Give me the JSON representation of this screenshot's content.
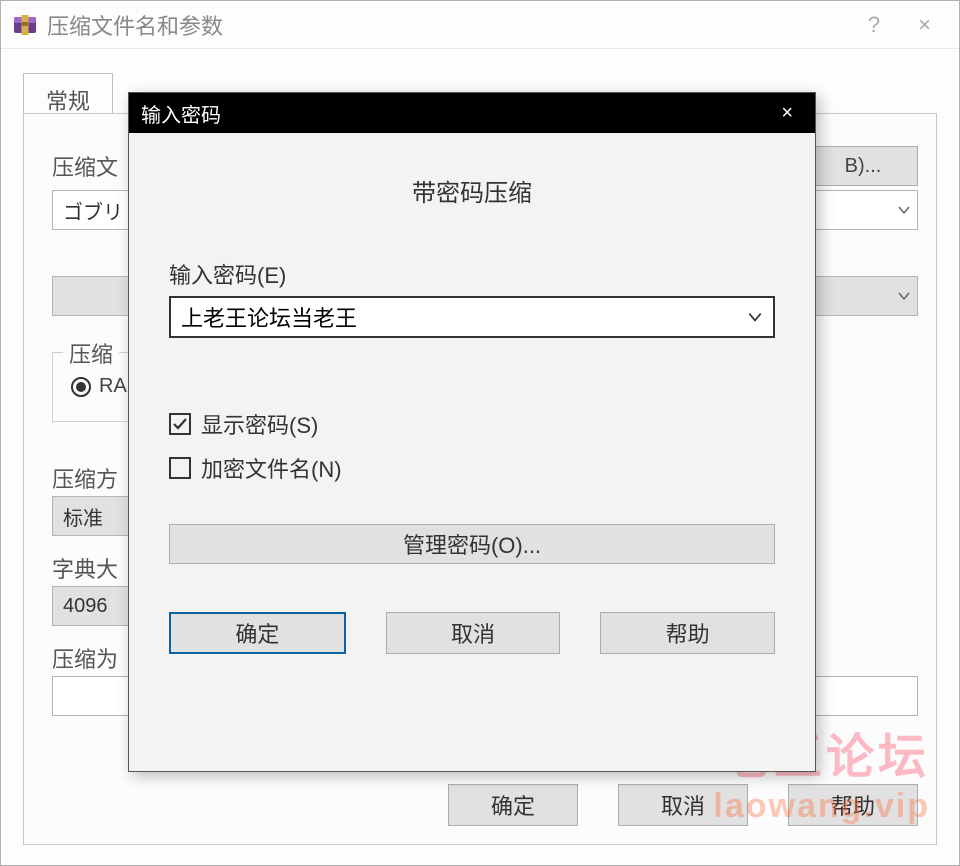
{
  "parent": {
    "title": "压缩文件名和参数",
    "help_char": "?",
    "close_char": "×",
    "tab_general": "常规",
    "label_archive_name": "压缩文",
    "archive_name_value": "ゴブリ",
    "browse_label": "B)...",
    "group_format": "压缩",
    "radio_rar": "RA",
    "label_method": "压缩方",
    "method_value": "标准",
    "label_dict": "字典大",
    "dict_value": "4096",
    "label_split": "压缩为",
    "btn_ok": "确定",
    "btn_cancel": "取消",
    "btn_help": "帮助"
  },
  "modal": {
    "title": "输入密码",
    "close_char": "×",
    "heading": "带密码压缩",
    "password_label": "输入密码(E)",
    "password_value": "上老王论坛当老王",
    "checkbox_show": "显示密码(S)",
    "checkbox_encrypt": "加密文件名(N)",
    "manage_label": "管理密码(O)...",
    "btn_ok": "确定",
    "btn_cancel": "取消",
    "btn_help": "帮助"
  },
  "watermark": {
    "line1": "老王论坛",
    "line2": "laowang.vip"
  }
}
